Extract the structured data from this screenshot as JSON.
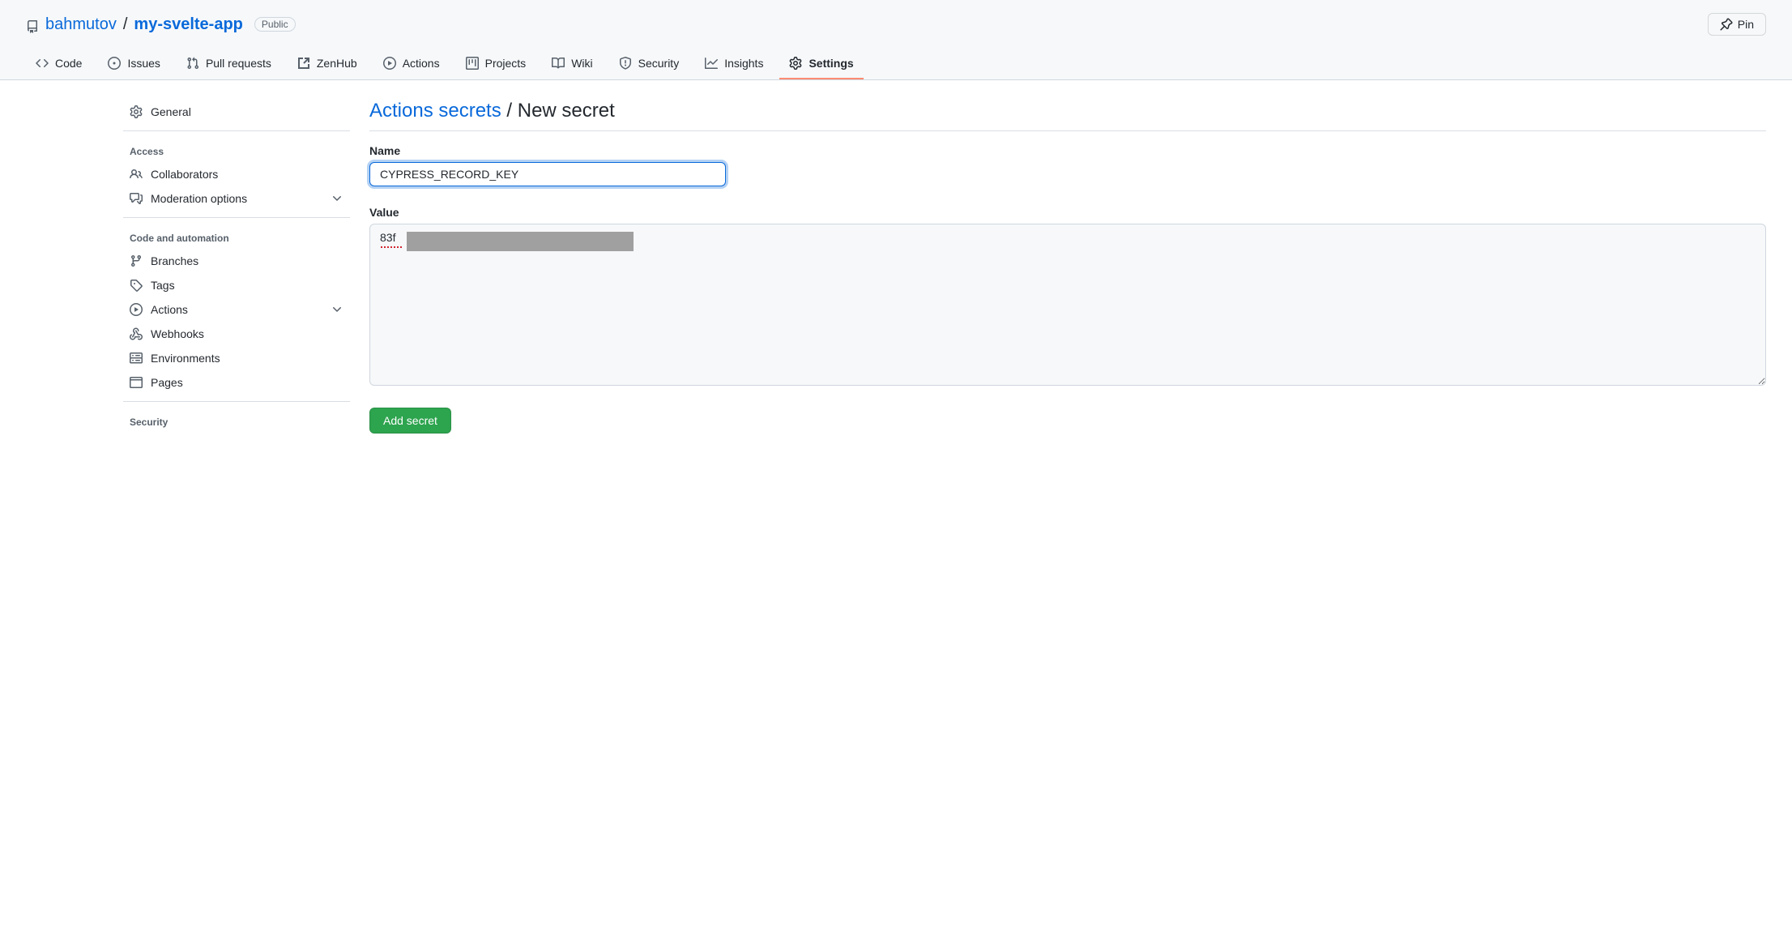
{
  "header": {
    "owner": "bahmutov",
    "repo": "my-svelte-app",
    "visibility_label": "Public",
    "pin_label": "Pin"
  },
  "tabs": {
    "code": "Code",
    "issues": "Issues",
    "pull_requests": "Pull requests",
    "zenhub": "ZenHub",
    "actions": "Actions",
    "projects": "Projects",
    "wiki": "Wiki",
    "security": "Security",
    "insights": "Insights",
    "settings": "Settings"
  },
  "sidebar": {
    "general": "General",
    "section_access": "Access",
    "collaborators": "Collaborators",
    "moderation": "Moderation options",
    "section_code": "Code and automation",
    "branches": "Branches",
    "tags": "Tags",
    "actions": "Actions",
    "webhooks": "Webhooks",
    "environments": "Environments",
    "pages": "Pages",
    "section_security": "Security"
  },
  "main": {
    "title_link": "Actions secrets",
    "title_slash": " / ",
    "title_rest": "New secret",
    "name_label": "Name",
    "name_value": "CYPRESS_RECORD_KEY",
    "value_label": "Value",
    "value_text": "83f",
    "submit_label": "Add secret"
  }
}
